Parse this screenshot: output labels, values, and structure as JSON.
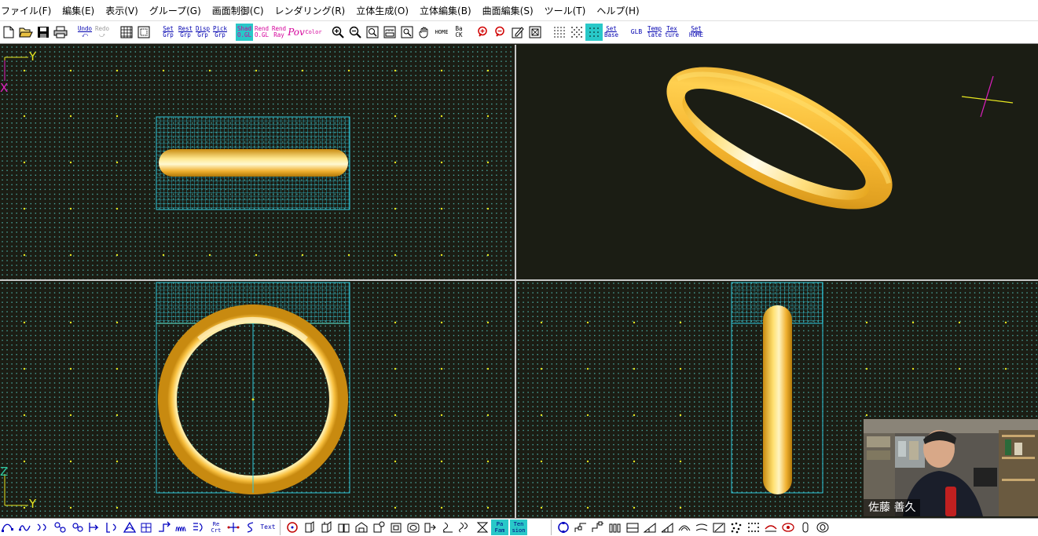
{
  "menu": [
    {
      "id": "file",
      "label": "ファイル(F)"
    },
    {
      "id": "edit",
      "label": "編集(E)"
    },
    {
      "id": "view",
      "label": "表示(V)"
    },
    {
      "id": "group",
      "label": "グループ(G)"
    },
    {
      "id": "screen-control",
      "label": "画面制御(C)"
    },
    {
      "id": "rendering",
      "label": "レンダリング(R)"
    },
    {
      "id": "solid-create",
      "label": "立体生成(O)"
    },
    {
      "id": "solid-edit",
      "label": "立体編集(B)"
    },
    {
      "id": "surface-edit",
      "label": "曲面編集(S)"
    },
    {
      "id": "tools",
      "label": "ツール(T)"
    },
    {
      "id": "help",
      "label": "ヘルプ(H)"
    }
  ],
  "toolbar": {
    "undo": [
      "Undo",
      ""
    ],
    "redo": [
      "Redo",
      ""
    ],
    "set_grp": [
      "Set",
      "Grp"
    ],
    "rest_grp": [
      "Rest",
      "Grp"
    ],
    "disp_grp": [
      "Disp",
      "Grp"
    ],
    "pick_grp": [
      "Pick",
      "Grp"
    ],
    "shad_ogl": [
      "Shad",
      "O.GL"
    ],
    "rend_ogl": [
      "Rend",
      "O.GL"
    ],
    "rend_ray": [
      "Rend",
      "Ray"
    ],
    "pov": "Pov",
    "color": "Color",
    "home": "HOME",
    "back": [
      "Ba",
      "CK"
    ],
    "set_base": [
      "Set",
      "Base"
    ],
    "glb": "GLB",
    "template": [
      "Temp",
      "late"
    ],
    "texture": [
      "Tex",
      "ture"
    ],
    "set_home": [
      "Set",
      "HOME"
    ]
  },
  "bottom_toolbar": {
    "text": "Text",
    "re_crt": [
      "Re",
      "Crt"
    ],
    "pa_fam": [
      "Pa",
      "Fam"
    ],
    "ten_sion": [
      "Ten",
      "sion"
    ]
  },
  "axes": {
    "top_vertical": "Y",
    "top_horizontal": "X",
    "front_vertical": "Z",
    "front_horizontal": "Y"
  },
  "colors": {
    "viewport_bg": "#1b1d14",
    "grid_dot": "#4aa8a0",
    "wire": "#2ec8dc",
    "gold": "#f2b430",
    "axis_yellow": "#e8e820",
    "axis_magenta": "#e020c0"
  },
  "webcam": {
    "name": "佐藤 善久"
  }
}
